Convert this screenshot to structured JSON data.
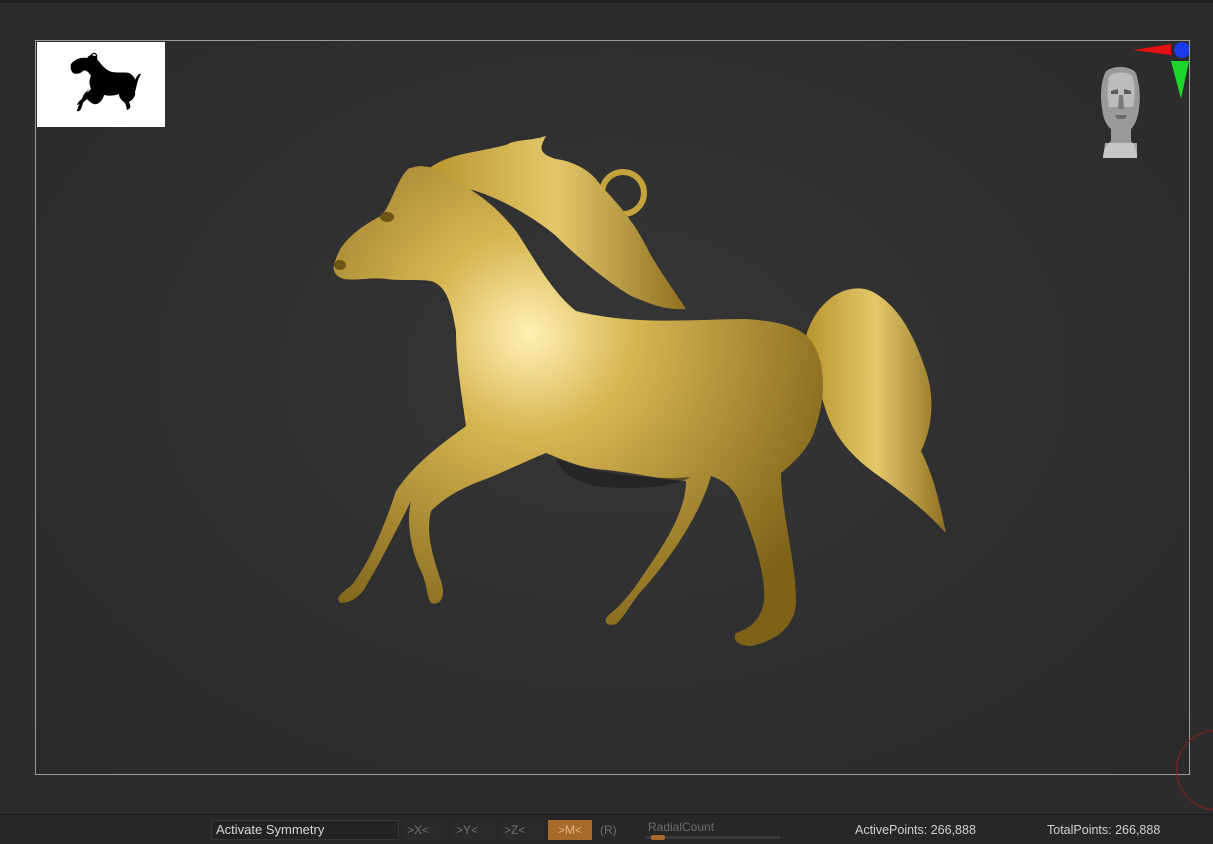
{
  "viewport": {
    "thumbnail_icon": "horse-silhouette-icon",
    "model_icon": "gold-horse-pendant-model",
    "nav_icon": "navigation-head-icon",
    "gizmo_icon": "axis-gizmo-icon"
  },
  "symmetry": {
    "label": "Activate Symmetry",
    "x": ">X<",
    "y": ">Y<",
    "z": ">Z<",
    "m": ">M<",
    "r": "(R)",
    "radial_label": "RadialCount",
    "radial_value_fraction": 0.1
  },
  "stats": {
    "active_points": "ActivePoints: 266,888",
    "total_points": "TotalPoints: 266,888"
  },
  "colors": {
    "accent_active": "#a66a2b",
    "gold": "#c9a63d",
    "background": "#2c2c2c"
  }
}
